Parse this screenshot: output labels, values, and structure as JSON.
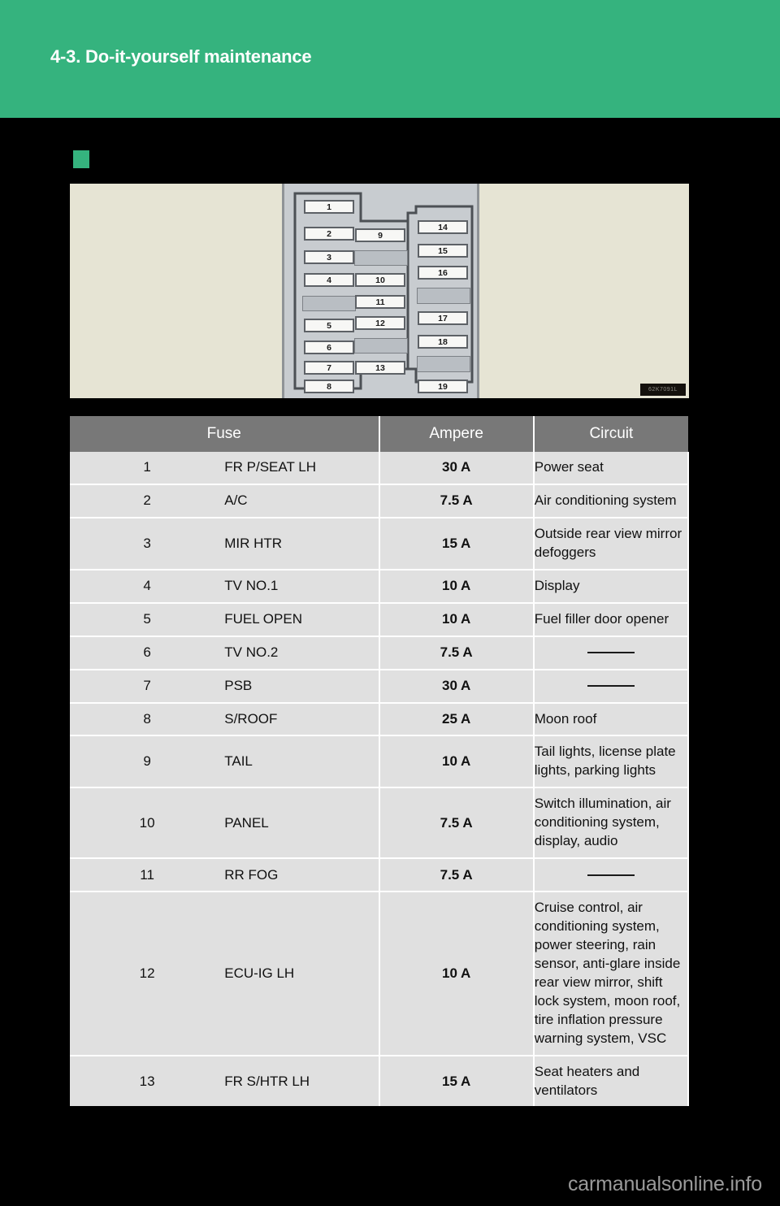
{
  "header": {
    "chapter_title": "4-3. Do-it-yourself maintenance",
    "accent_color": "#35b37e"
  },
  "section": {
    "bullet_color": "#35b37e",
    "bullet_label": ""
  },
  "illustration": {
    "panel_background": "#e6e4d4",
    "fusebox_background": "#c8ccd0",
    "image_stamp": "62K7091L",
    "fuse_positions": {
      "left_column": [
        "1",
        "2",
        "3",
        "4",
        "5",
        "6",
        "7",
        "8"
      ],
      "middle_column": [
        "9",
        "10",
        "11",
        "12",
        "13"
      ],
      "right_column": [
        "14",
        "15",
        "16",
        "17",
        "18",
        "19"
      ]
    }
  },
  "table": {
    "headers": [
      "Fuse",
      "Ampere",
      "Circuit"
    ],
    "header_background": "#787878",
    "cell_background": "#e0e0e0",
    "rows": [
      {
        "no": "1",
        "name": "FR P/SEAT LH",
        "ampere": "30 A",
        "circuit": "Power seat"
      },
      {
        "no": "2",
        "name": "A/C",
        "ampere": "7.5 A",
        "circuit": "Air conditioning system"
      },
      {
        "no": "3",
        "name": "MIR HTR",
        "ampere": "15 A",
        "circuit": "Outside rear view mirror defoggers"
      },
      {
        "no": "4",
        "name": "TV NO.1",
        "ampere": "10 A",
        "circuit": "Display"
      },
      {
        "no": "5",
        "name": "FUEL OPEN",
        "ampere": "10 A",
        "circuit": "Fuel filler door opener"
      },
      {
        "no": "6",
        "name": "TV NO.2",
        "ampere": "7.5 A",
        "circuit": ""
      },
      {
        "no": "7",
        "name": "PSB",
        "ampere": "30 A",
        "circuit": ""
      },
      {
        "no": "8",
        "name": "S/ROOF",
        "ampere": "25 A",
        "circuit": "Moon roof"
      },
      {
        "no": "9",
        "name": "TAIL",
        "ampere": "10 A",
        "circuit": "Tail lights, license plate lights, parking lights"
      },
      {
        "no": "10",
        "name": "PANEL",
        "ampere": "7.5 A",
        "circuit": "Switch illumination, air conditioning system, display, audio"
      },
      {
        "no": "11",
        "name": "RR FOG",
        "ampere": "7.5 A",
        "circuit": ""
      },
      {
        "no": "12",
        "name": "ECU-IG LH",
        "ampere": "10 A",
        "circuit": "Cruise control, air conditioning system, power steering, rain sensor, anti-glare inside rear view mirror, shift lock system, moon roof, tire inflation pressure warning system, VSC"
      },
      {
        "no": "13",
        "name": "FR S/HTR LH",
        "ampere": "15 A",
        "circuit": "Seat heaters and ventilators"
      }
    ]
  },
  "footer": {
    "watermark": "carmanualsonline.info"
  }
}
